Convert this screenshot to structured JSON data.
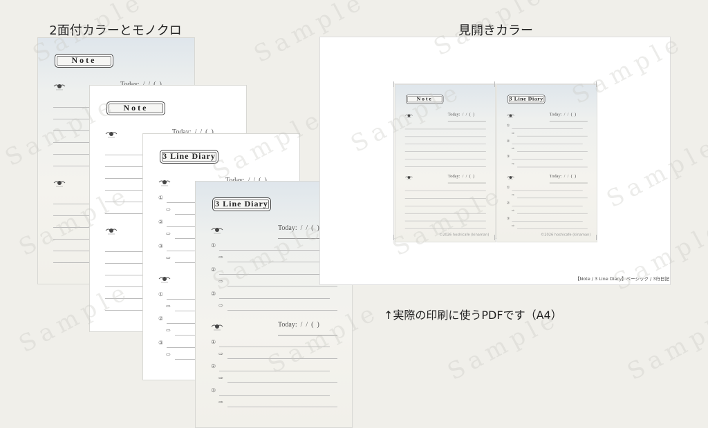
{
  "headings": {
    "left": "2面付カラーとモノクロ",
    "right": "見開きカラー"
  },
  "caption": "↑実際の印刷に使うPDFです（A4）",
  "footer": "【Note / 3 Line Diary】ベーシック / 3行日記",
  "watermark": "Sample",
  "template": {
    "note_label": "Note",
    "diary_label": "3 Line Diary",
    "today": "Today:  /  /  (  )",
    "numbers": [
      "①",
      "②",
      "③"
    ],
    "arrow": "⇨",
    "copyright": "©2026 hoshicafe (kinaman)"
  },
  "colors": {
    "background": "#f0efea",
    "page_tint": "#dfe6ec"
  }
}
